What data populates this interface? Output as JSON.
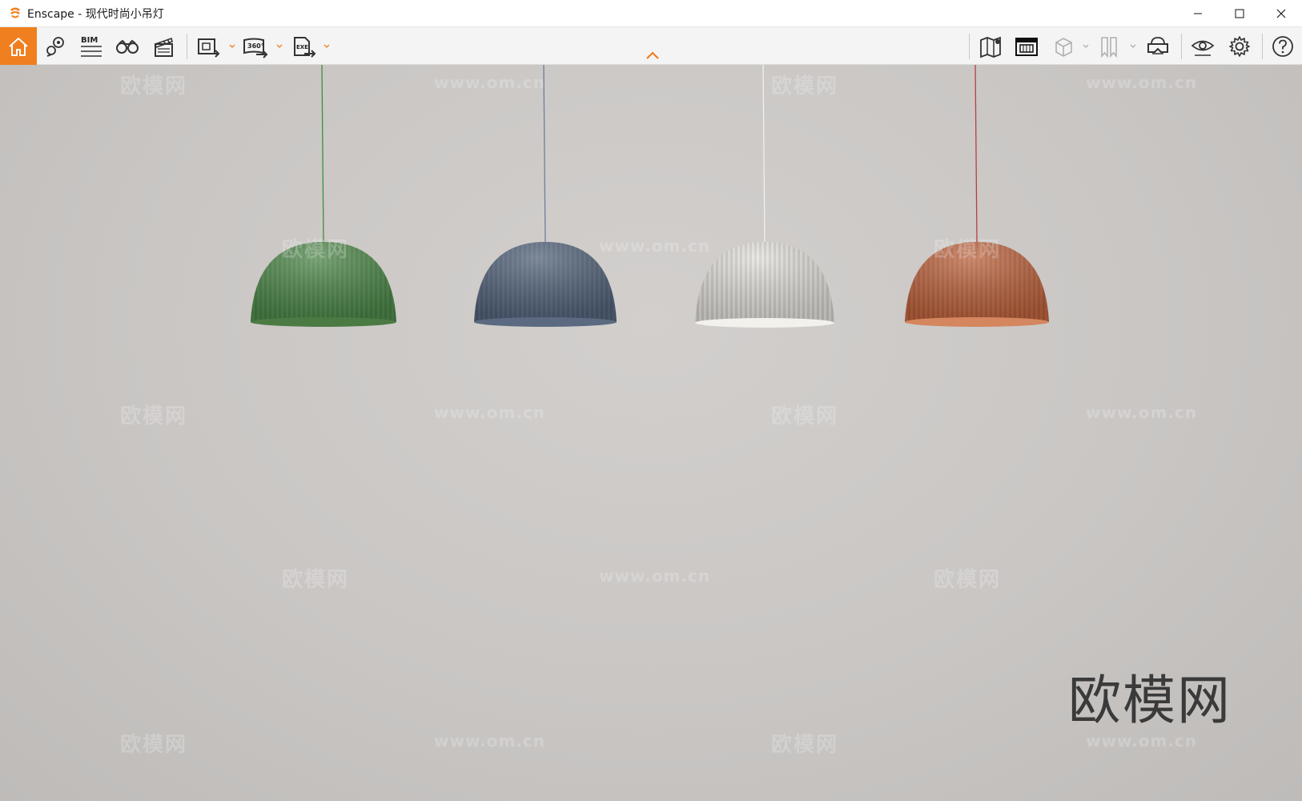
{
  "window": {
    "title": "Enscape - 现代时尚小吊灯",
    "controls": [
      "minimize",
      "maximize",
      "close"
    ]
  },
  "toolbar": {
    "accent_color": "#f07f1f",
    "left_tools": [
      {
        "name": "home-icon"
      },
      {
        "name": "views-icon"
      },
      {
        "name": "bim-icon",
        "label": "BIM"
      },
      {
        "name": "binoculars-icon"
      },
      {
        "name": "clapperboard-icon"
      },
      {
        "name": "screenshot-export-icon",
        "dropdown": true
      },
      {
        "name": "panorama-360-icon",
        "label": "360°",
        "dropdown": true
      },
      {
        "name": "exe-export-icon",
        "label": "EXE",
        "dropdown": true
      }
    ],
    "right_tools": [
      {
        "name": "map-icon"
      },
      {
        "name": "asset-library-icon"
      },
      {
        "name": "cube-icon",
        "dropdown": true
      },
      {
        "name": "bookmarks-icon",
        "dropdown": true
      },
      {
        "name": "vr-headset-icon"
      },
      {
        "name": "eye-icon"
      },
      {
        "name": "settings-icon"
      },
      {
        "name": "help-icon"
      }
    ]
  },
  "viewport": {
    "background_color": "#cac7c5",
    "lamps": [
      {
        "color": "#4f8a4c",
        "cord": "#3f8f3a"
      },
      {
        "color": "#56677e",
        "cord": "#6d7f9b"
      },
      {
        "color": "#e4e1dc",
        "cord": "#f0f0f0"
      },
      {
        "color": "#c0653f",
        "cord": "#b54040"
      }
    ],
    "watermark_text": "欧模网",
    "watermark_url": "www.om.cn",
    "watermark_big": "欧模网"
  }
}
